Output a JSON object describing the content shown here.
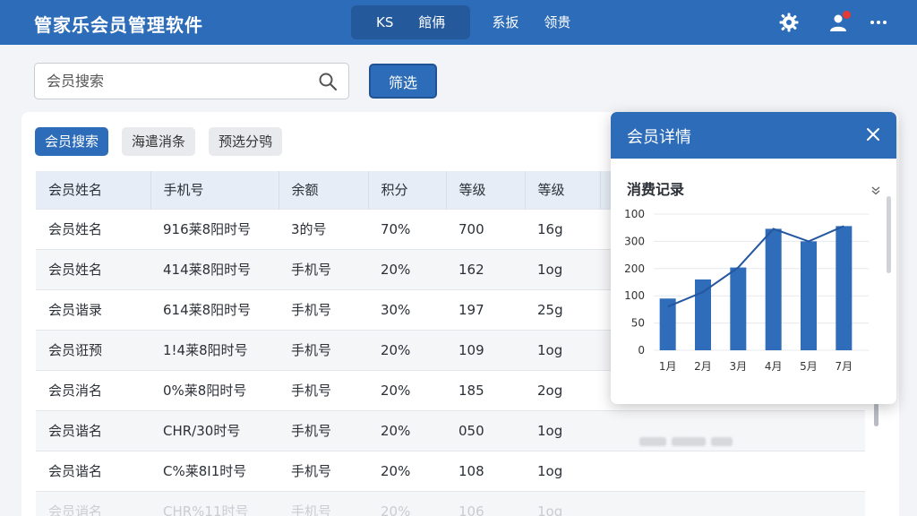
{
  "app": {
    "title": "管家乐会员管理软件",
    "nav": {
      "active_group": [
        "KS",
        "館侢"
      ],
      "items": [
        "系扳",
        "领贵"
      ]
    },
    "icons": [
      "settings-gear-icon",
      "user-notify-icon",
      "more-dots-icon"
    ]
  },
  "search": {
    "placeholder": "会员搜索",
    "filter_label": "筛选"
  },
  "chips": [
    "会员搜索",
    "海遣消条",
    "预选分鸮"
  ],
  "table": {
    "headers": [
      "会员姓名",
      "手机号",
      "余额",
      "积分",
      "等级",
      "等级"
    ],
    "rows": [
      [
        "会员姓名",
        "916莱8阳时号",
        "3的号",
        "70%",
        "700",
        "16g"
      ],
      [
        "会员姓名",
        "414莱8阳时号",
        "手机号",
        "20%",
        "162",
        "1og"
      ],
      [
        "会员谐录",
        "614莱8阳时号",
        "手机号",
        "30%",
        "197",
        "25g"
      ],
      [
        "会员诳预",
        "1!4莱8阳时号",
        "手机号",
        "20%",
        "109",
        "1og"
      ],
      [
        "会员消名",
        "0%莱8阳时号",
        "手机号",
        "20%",
        "185",
        "2og"
      ],
      [
        "会员谐名",
        "CHR/30时号",
        "手机号",
        "20%",
        "050",
        "1og"
      ],
      [
        "会员谐名",
        "C%莱8I1时号",
        "手机号",
        "20%",
        "108",
        "1og"
      ],
      [
        "会员诮名",
        "CHR%11时号",
        "手机号",
        "20%",
        "106",
        "1og"
      ]
    ]
  },
  "detail": {
    "title": "会员详情",
    "section_title": "消费记录",
    "close_icon": "close-icon",
    "collapse_icon": "chevron-double-down-icon"
  },
  "chart_data": {
    "type": "bar",
    "categories": [
      "1月",
      "2月",
      "3月",
      "4月",
      "5月",
      "7月"
    ],
    "values": [
      95,
      130,
      152,
      223,
      200,
      228
    ],
    "line_values": [
      80,
      107,
      152,
      223,
      200,
      228
    ],
    "y_tick_labels": [
      "0",
      "50",
      "100",
      "200",
      "300",
      "100"
    ],
    "y_tick_values": [
      0,
      50,
      100,
      150,
      200,
      250
    ],
    "ylim": [
      0,
      250
    ],
    "grid": true,
    "bar_color": "#2f6cb9",
    "line_color": "#2557a0"
  },
  "colors": {
    "primary": "#2d6cb8",
    "primary_dark": "#245a9c",
    "notify": "#e53935"
  }
}
